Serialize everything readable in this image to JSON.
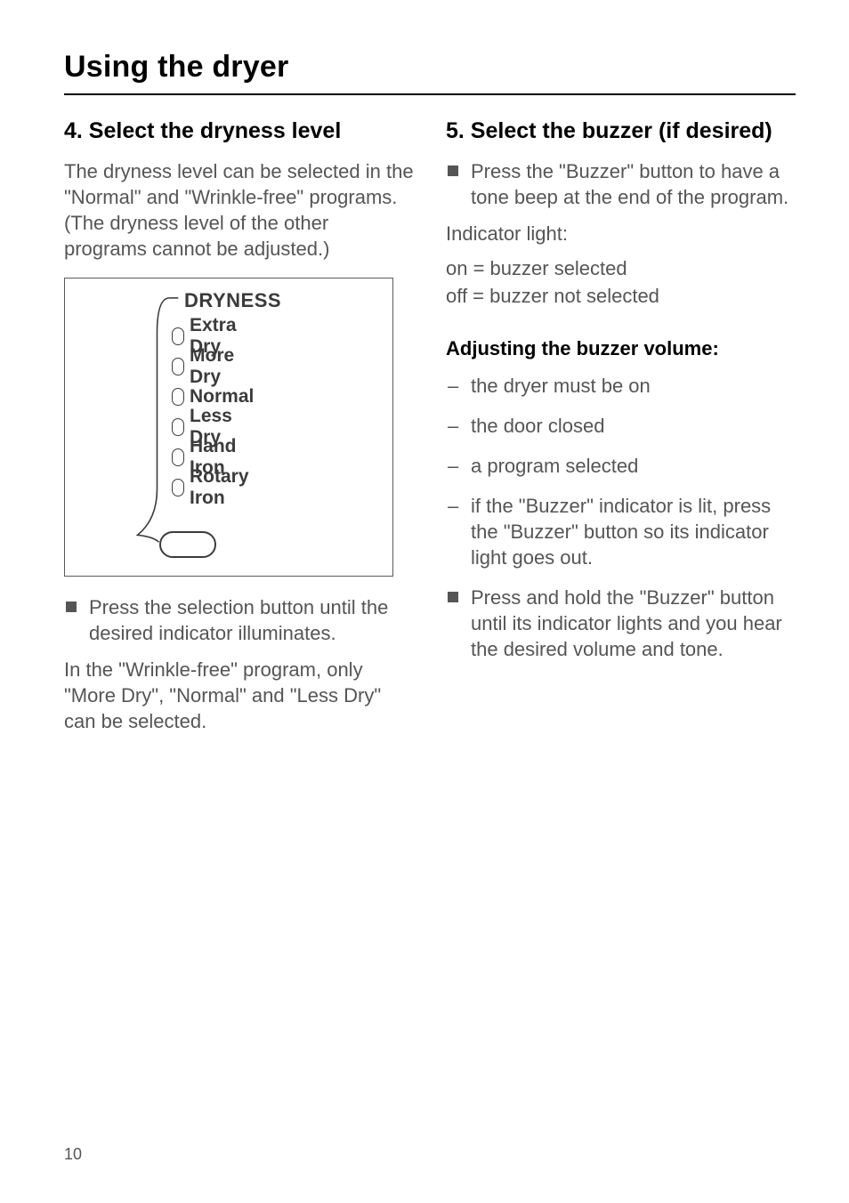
{
  "page_title": "Using the dryer",
  "page_number": "10",
  "left": {
    "heading": "4. Select the dryness level",
    "intro": "The dryness level can be selected in the \"Normal\" and \"Wrinkle-free\" programs. (The dryness level of the other programs cannot be adjusted.)",
    "figure": {
      "title": "DRYNESS",
      "options": [
        "Extra Dry",
        "More Dry",
        "Normal",
        "Less Dry",
        "Hand Iron",
        "Rotary Iron"
      ]
    },
    "bullet": "Press the selection button until the desired indicator illuminates.",
    "outro": "In the \"Wrinkle-free\" program, only \"More Dry\", \"Normal\" and \"Less Dry\" can be selected."
  },
  "right": {
    "heading": "5. Select the buzzer (if desired)",
    "bullet1": "Press the \"Buzzer\" button to have a tone beep at the end of the program.",
    "indicator_label": "Indicator light:",
    "indicator_on": "on = buzzer selected",
    "indicator_off": "off = buzzer not selected",
    "sub_heading": "Adjusting the buzzer volume:",
    "dashes": [
      "the dryer must be on",
      "the door closed",
      "a program selected",
      "if the \"Buzzer\" indicator is lit, press the \"Buzzer\" button so its indicator light goes out."
    ],
    "bullet2": "Press and hold the \"Buzzer\" button until its indicator lights and you hear the desired volume and tone."
  }
}
